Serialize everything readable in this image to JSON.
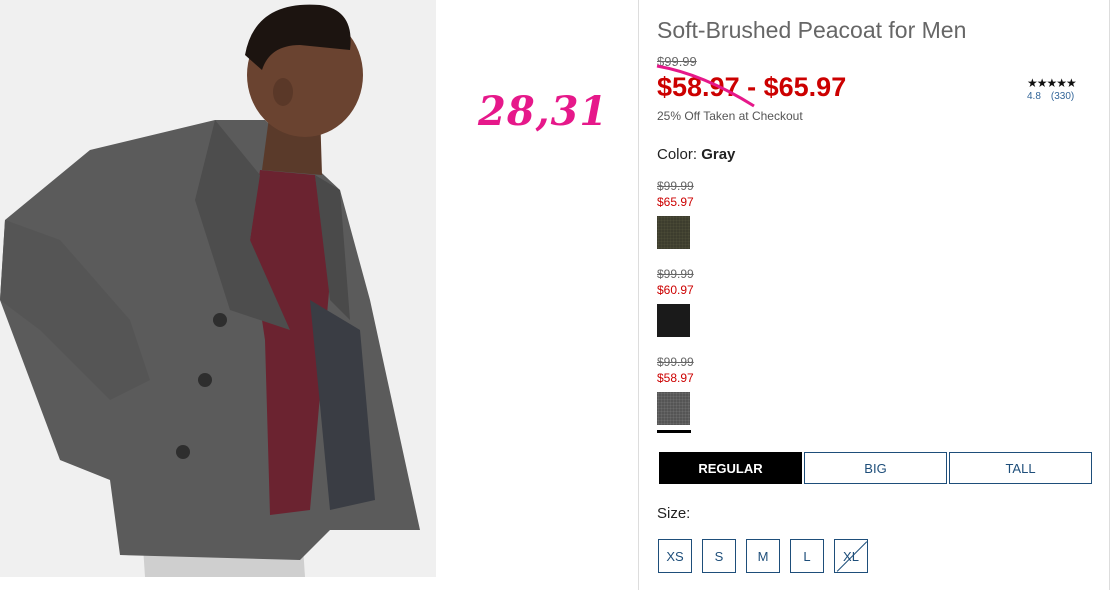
{
  "annotation": "28,31",
  "product": {
    "title": "Soft-Brushed Peacoat for Men",
    "original_price": "$99.99",
    "sale_price_low": "$58.97",
    "sale_price_sep": "-",
    "sale_price_high": "$65.97",
    "promo": "25% Off Taken at Checkout",
    "rating_stars": "★★★★★",
    "rating_value": "4.8",
    "rating_count": "(330)"
  },
  "color": {
    "label": "Color:",
    "selected": "Gray",
    "swatches": [
      {
        "original": "$99.99",
        "sale": "$65.97",
        "name": "olive-swatch"
      },
      {
        "original": "$99.99",
        "sale": "$60.97",
        "name": "black-swatch"
      },
      {
        "original": "$99.99",
        "sale": "$58.97",
        "name": "gray-swatch"
      }
    ]
  },
  "fit_tabs": [
    "REGULAR",
    "BIG",
    "TALL"
  ],
  "size": {
    "label": "Size:",
    "options": [
      "XS",
      "S",
      "M",
      "L",
      "XL"
    ]
  },
  "colors": {
    "sale_red": "#cc0000",
    "link_blue": "#1e4e7a",
    "annotation_pink": "#e6188a"
  }
}
